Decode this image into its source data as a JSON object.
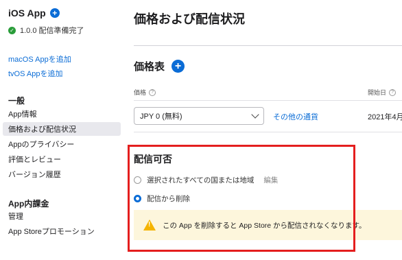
{
  "sidebar": {
    "app_title": "iOS App",
    "status": "1.0.0 配信準備完了",
    "links": [
      "macOS Appを追加",
      "tvOS Appを追加"
    ],
    "section_general": "一般",
    "general_items": [
      "App情報",
      "価格および配信状況",
      "Appのプライバシー",
      "評価とレビュー",
      "バージョン履歴"
    ],
    "section_iap": "App内課金",
    "iap_items": [
      "管理",
      "App Storeプロモーション"
    ]
  },
  "main": {
    "page_title": "価格および配信状況",
    "price_section_title": "価格表",
    "price_col_label": "価格",
    "start_col_label": "開始日",
    "price_select_value": "JPY 0 (無料)",
    "other_currency_link": "その他の通貨",
    "start_date": "2021年4月",
    "availability_title": "配信可否",
    "radio_all": "選択されたすべての国または地域",
    "radio_edit": "編集",
    "radio_remove": "配信から削除",
    "warning_text": "この App を削除すると App Store から配信されなくなります。"
  },
  "colors": {
    "accent": "#0a6cd6",
    "highlight": "#e41e1e",
    "warning_bg": "#fdf6dc",
    "warning_icon": "#f5b400"
  }
}
